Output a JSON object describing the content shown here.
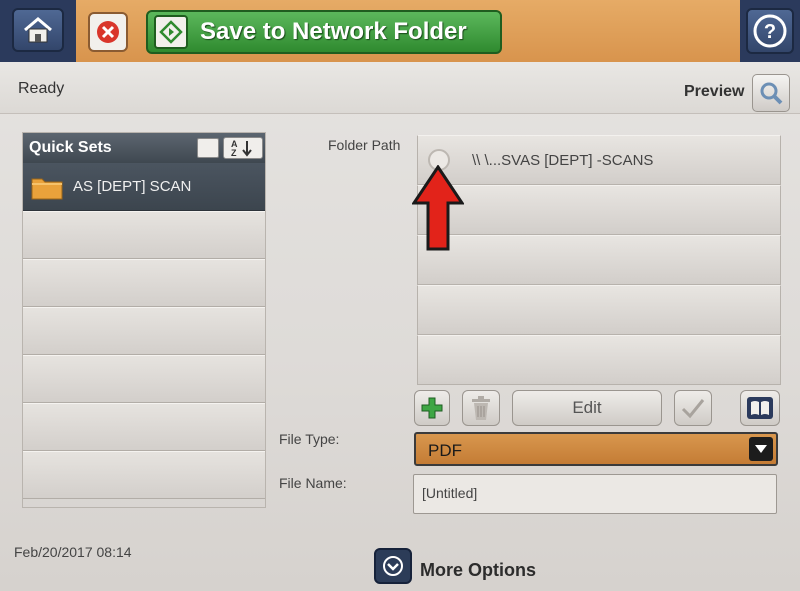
{
  "header": {
    "home_icon": "home-icon",
    "cancel_icon": "cancel-icon",
    "start_label": "Save to Network Folder",
    "help_icon": "help-icon"
  },
  "status": {
    "text": "Ready",
    "preview_label": "Preview"
  },
  "quick_sets": {
    "title": "Quick Sets",
    "sort_icon": "sort-az-icon",
    "items": [
      {
        "label": "AS [DEPT] SCAN",
        "icon": "folder-icon"
      }
    ]
  },
  "folder_path": {
    "label": "Folder Path",
    "paths": [
      "\\\\ \\...SVAS [DEPT] -SCANS"
    ]
  },
  "actions": {
    "add_icon": "add-icon",
    "delete_icon": "trash-icon",
    "edit_label": "Edit",
    "check_icon": "check-icon",
    "address_book_icon": "book-icon"
  },
  "file_type": {
    "label": "File Type:",
    "value": "PDF"
  },
  "file_name": {
    "label": "File Name:",
    "value": "[Untitled]"
  },
  "footer": {
    "datetime": "Feb/20/2017 08:14",
    "more_options_label": "More Options"
  },
  "colors": {
    "accent_orange": "#d8944d",
    "start_green": "#3c9a3c",
    "nav_blue": "#2b3a5c",
    "annotation_red": "#e2231a"
  }
}
